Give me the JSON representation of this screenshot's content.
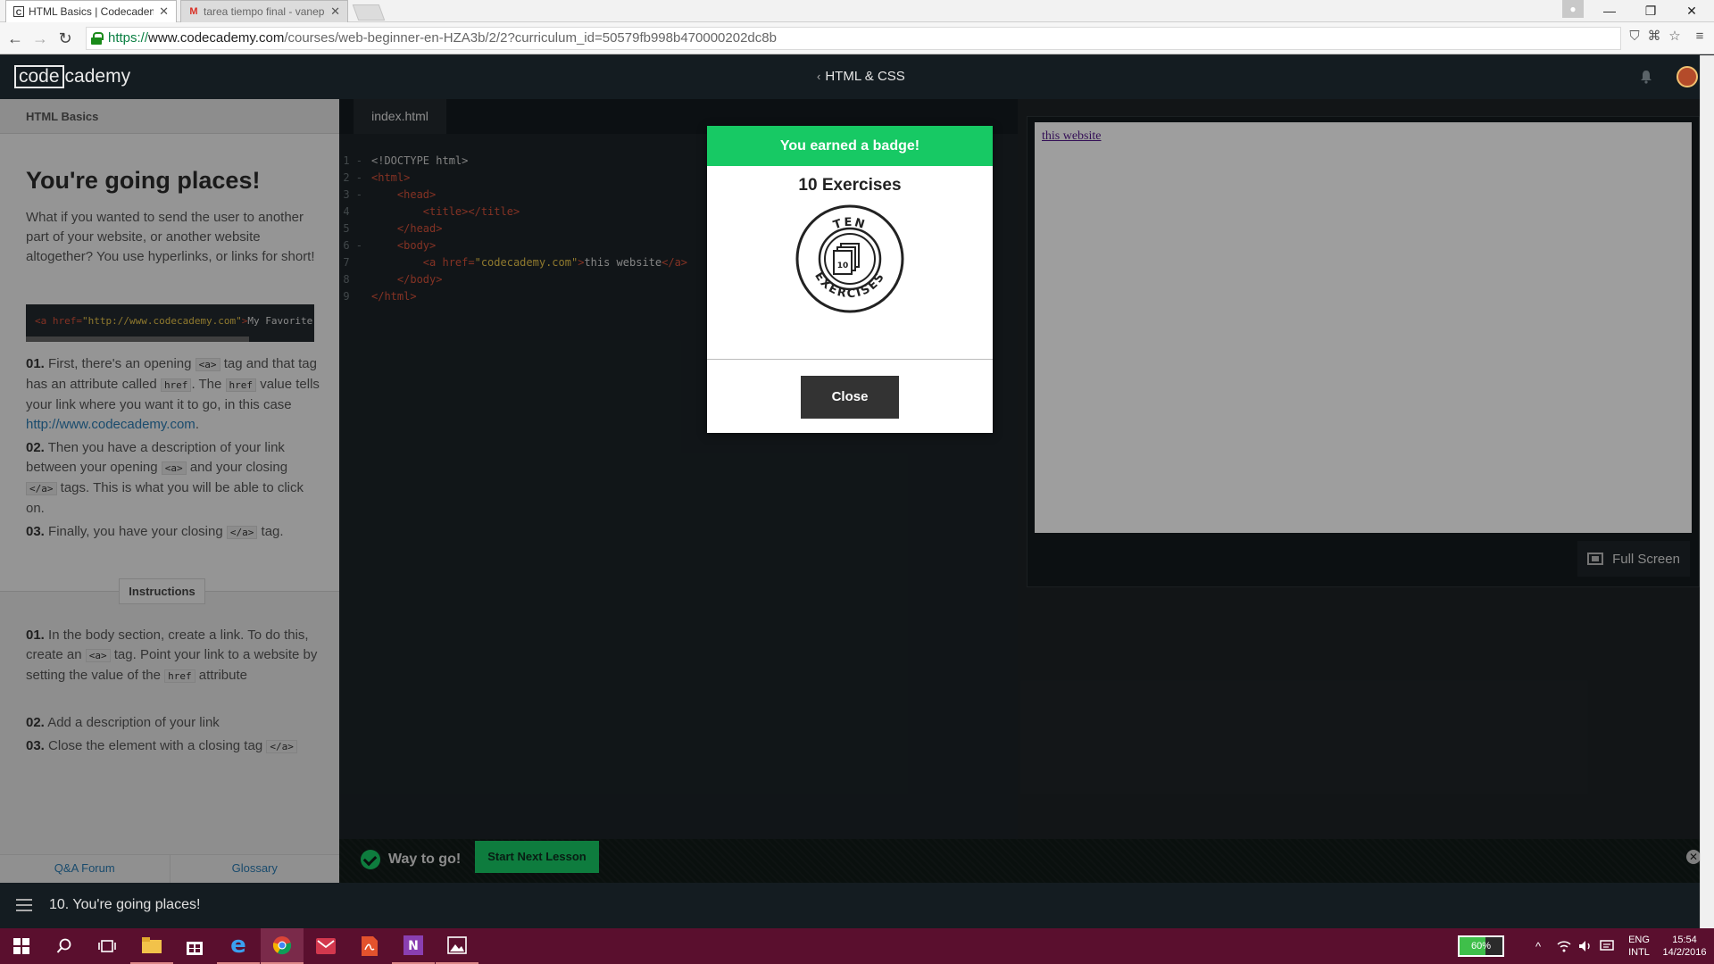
{
  "browser": {
    "tabs": [
      {
        "title": "HTML Basics | Codecadem",
        "icon": "codecademy-favicon",
        "active": true
      },
      {
        "title": "tarea tiempo final - vanep",
        "icon": "gmail-favicon",
        "active": false
      }
    ],
    "url": {
      "scheme": "https://",
      "host": "www.codecademy.com",
      "path": "/courses/web-beginner-en-HZA3b/2/2?curriculum_id=50579fb998b470000202dc8b"
    }
  },
  "header": {
    "logo_part1": "code",
    "logo_part2": "cademy",
    "course_title": "HTML & CSS"
  },
  "left_panel": {
    "section": "HTML Basics",
    "title": "You're going places!",
    "intro": "What if you wanted to send the user to another part of your website, or another website altogether? You use hyperlinks, or links for short!",
    "code_example": {
      "open": "<a href=",
      "href": "\"http://www.codecademy.com\"",
      "close": ">",
      "text": "My Favorite"
    },
    "steps": [
      {
        "num": "01.",
        "t1": "First, there's an opening",
        "c1": "<a>",
        "t2": "tag and that tag has an attribute called",
        "c2": "href",
        "t3": ". The",
        "c3": "href",
        "t4": "value tells your link where you want it to go, in this case",
        "link": "http://www.codecademy.com",
        "t5": "."
      },
      {
        "num": "02.",
        "t1": "Then you have a description of your link between your opening",
        "c1": "<a>",
        "t2": "and your closing",
        "c2": "</a>",
        "t3": "tags. This is what you will be able to click on."
      },
      {
        "num": "03.",
        "t1": "Finally, you have your closing",
        "c1": "</a>",
        "t2": "tag."
      }
    ],
    "instructions_tab": "Instructions",
    "instructions": [
      {
        "num": "01.",
        "t1": "In the body section, create a link. To do this, create an",
        "c1": "<a>",
        "t2": "tag. Point your link to a website by setting the value of the",
        "c2": "href",
        "t3": "attribute"
      },
      {
        "num": "02.",
        "t1": "Add a description of your link"
      },
      {
        "num": "03.",
        "t1": "Close the element with a closing tag",
        "c1": "</a>"
      }
    ],
    "footer": {
      "qa": "Q&A Forum",
      "glossary": "Glossary"
    }
  },
  "editor": {
    "filename": "index.html",
    "lines": [
      {
        "n": "1",
        "fold": "-",
        "parts": [
          [
            "docc",
            "<!DOCTYPE"
          ],
          [
            "txtc",
            " html>"
          ]
        ]
      },
      {
        "n": "2",
        "fold": "-",
        "parts": [
          [
            "tagc",
            "<html>"
          ]
        ]
      },
      {
        "n": "3",
        "fold": "-",
        "parts": [
          [
            "tagc",
            "    <head>"
          ]
        ]
      },
      {
        "n": "4",
        "fold": "",
        "parts": [
          [
            "tagc",
            "        <title></title>"
          ]
        ]
      },
      {
        "n": "5",
        "fold": "",
        "parts": [
          [
            "tagc",
            "    </head>"
          ]
        ]
      },
      {
        "n": "6",
        "fold": "-",
        "parts": [
          [
            "tagc",
            "    <body>"
          ]
        ]
      },
      {
        "n": "7",
        "fold": "",
        "parts": [
          [
            "tagc",
            "        <a href="
          ],
          [
            "strc",
            "\"codecademy.com\""
          ],
          [
            "tagc",
            ">"
          ],
          [
            "txtc",
            "this website"
          ],
          [
            "tagc",
            "</a>"
          ]
        ]
      },
      {
        "n": "8",
        "fold": "",
        "parts": [
          [
            "tagc",
            "    </body>"
          ]
        ]
      },
      {
        "n": "9",
        "fold": "",
        "parts": [
          [
            "tagc",
            "</html>"
          ]
        ]
      }
    ]
  },
  "preview": {
    "link_text": "this website",
    "fullscreen_label": "Full Screen"
  },
  "success_bar": {
    "message": "Way to go!",
    "next_button": "Start Next Lesson"
  },
  "lesson_bar": {
    "lesson": "10. You're going places!"
  },
  "modal": {
    "header": "You earned a badge!",
    "badge_title": "10 Exercises",
    "badge_top_text": "TEN",
    "badge_bottom_text": "EXERCISES",
    "badge_number": "10",
    "close_label": "Close"
  },
  "taskbar": {
    "apps": [
      "windows-start-icon",
      "search-icon",
      "task-view-icon",
      "file-explorer-icon",
      "store-icon",
      "edge-icon",
      "chrome-icon",
      "mail-icon",
      "acrobat-icon",
      "onenote-icon",
      "photos-icon"
    ],
    "battery_label": "60%",
    "battery_level": 0.6,
    "lang_1": "ENG",
    "lang_2": "INTL",
    "time": "15:54",
    "date": "14/2/2016"
  },
  "colors": {
    "accent": "#17c964",
    "taskbar": "#5a0f2e",
    "editor_tag": "#d6513a",
    "editor_string": "#e6c24a"
  }
}
